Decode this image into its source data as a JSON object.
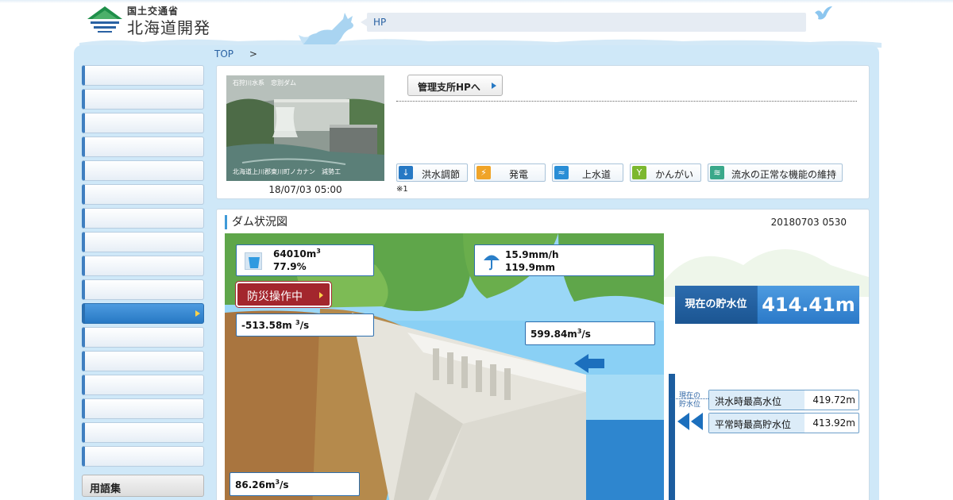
{
  "header": {
    "ministry": "国土交通省",
    "bureau": "北海道開発局",
    "hp_label": "HP"
  },
  "breadcrumb": {
    "top": "TOP",
    "separator": ">"
  },
  "sidebar": {
    "items": [
      "",
      "",
      "",
      "",
      "",
      "",
      "",
      "",
      "",
      "",
      "",
      "",
      "",
      "",
      "",
      "",
      ""
    ],
    "active_index": 10,
    "glossary": "用語集"
  },
  "camera": {
    "caption": "石狩川水系　忠別ダム",
    "bottom_caption": "北海道上川郡東川町ノカナン　減勢工",
    "timestamp": "18/07/03 05:00"
  },
  "office_button": "管理支所HPへ",
  "purposes": [
    {
      "label": "洪水調節",
      "icon": "flood-control-icon",
      "color": "#2779c4"
    },
    {
      "label": "発電",
      "icon": "power-icon",
      "color": "#f0a428"
    },
    {
      "label": "上水道",
      "icon": "water-supply-icon",
      "color": "#2a8ed6"
    },
    {
      "label": "かんがい",
      "icon": "irrigation-icon",
      "color": "#7cb82f"
    },
    {
      "label": "流水の正常な機能の維持",
      "icon": "river-flow-icon",
      "color": "#3aa88a"
    }
  ],
  "note": "※1",
  "dam_status": {
    "title": "ダム状況図",
    "datetime": "20180703 0530",
    "storage_volume": "64010m",
    "storage_rate": "77.9%",
    "rain_rate": "15.9mm/h",
    "rain_total": "119.9mm",
    "operation_button": "防災操作中",
    "outflow": "-513.58m",
    "inflow": "599.84m",
    "discharge": "86.26m",
    "unit_sup": "3",
    "unit_suffix": "/s",
    "current_level_label": "現在の貯水位",
    "current_level_value": "414.41m",
    "current_marker_line1": "現在の",
    "current_marker_line2": "貯水位",
    "flood_max_label": "洪水時最高水位",
    "flood_max_value": "419.72m",
    "normal_max_label": "平常時最高貯水位",
    "normal_max_value": "413.92m"
  },
  "colors": {
    "frame": "#cfe8f8",
    "accent": "#2779c4",
    "alert": "#a3262d",
    "water": "#7fc9f3"
  }
}
